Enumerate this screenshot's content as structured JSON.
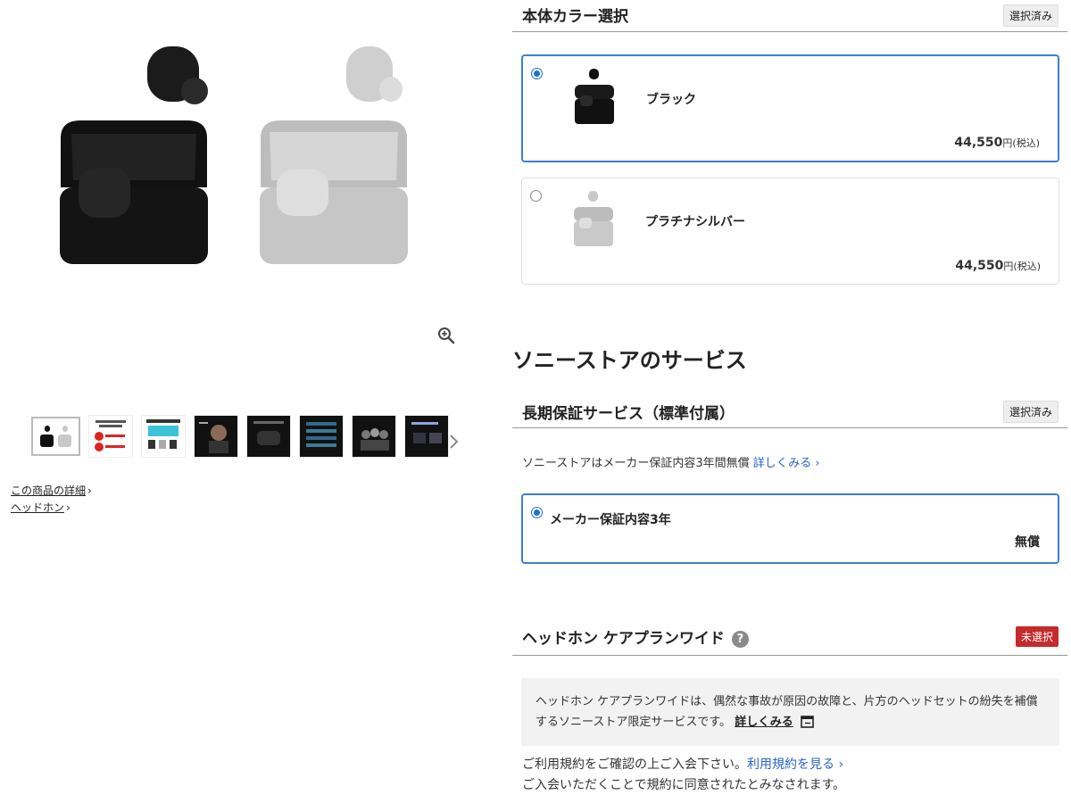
{
  "left": {
    "zoom_icon": "zoom-in-icon",
    "thumbnail_count": 8,
    "links": [
      {
        "label": "この商品の詳細"
      },
      {
        "label": "ヘッドホン"
      }
    ]
  },
  "color_section": {
    "title": "本体カラー選択",
    "badge": "選択済み",
    "options": [
      {
        "name": "ブラック",
        "price": "44,550",
        "price_suffix": "円(税込)",
        "selected": true
      },
      {
        "name": "プラチナシルバー",
        "price": "44,550",
        "price_suffix": "円(税込)",
        "selected": false
      }
    ]
  },
  "services": {
    "title": "ソニーストアのサービス",
    "warranty": {
      "title": "長期保証サービス（標準付属）",
      "badge": "選択済み",
      "description": "ソニーストアはメーカー保証内容3年間無償",
      "more_link": "詳しくみる",
      "option_name": "メーカー保証内容3年",
      "option_price": "無償"
    },
    "careplan": {
      "title": "ヘッドホン ケアプランワイド",
      "badge": "未選択",
      "description": "ヘッドホン ケアプランワイドは、偶然な事故が原因の故障と、片方のヘッドセットの紛失を補償するソニーストア限定サービスです。",
      "more_link": "詳しくみる",
      "terms_line1": "ご利用規約をご確認の上ご入会下さい。",
      "terms_link": "利用規約を見る",
      "terms_line2": "ご入会いただくことで規約に同意されたとみなされます。"
    }
  },
  "colors": {
    "accent_blue": "#3d7fd4",
    "link_blue": "#2a64c7",
    "unselected_red": "#c42b2b"
  }
}
